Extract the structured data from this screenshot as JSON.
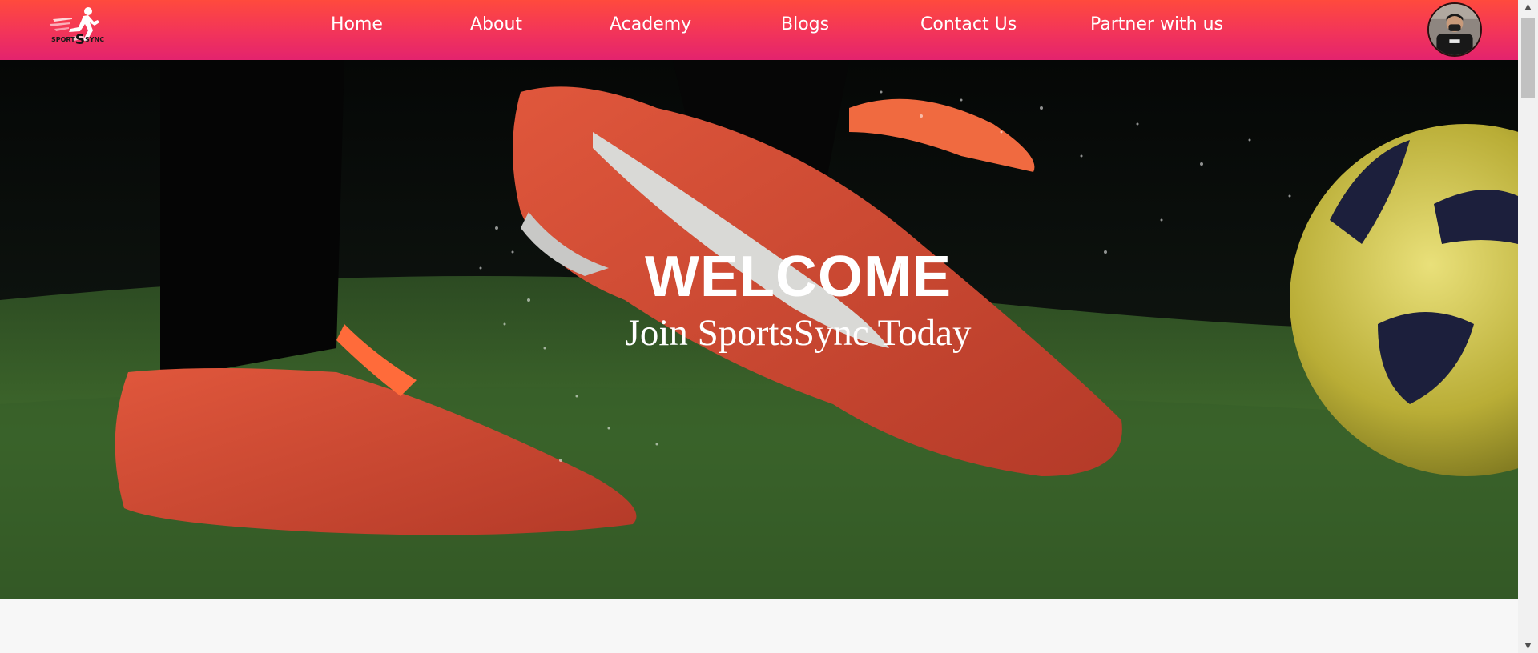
{
  "logo": {
    "prefix": "SPORT",
    "initial": "S",
    "suffix": "SYNC",
    "icon": "runner-icon"
  },
  "nav": {
    "items": [
      {
        "label": "Home"
      },
      {
        "label": "About"
      },
      {
        "label": "Academy"
      },
      {
        "label": "Blogs"
      },
      {
        "label": "Contact Us"
      },
      {
        "label": "Partner with us"
      }
    ],
    "avatar_icon": "user-avatar"
  },
  "hero": {
    "title": "WELCOME",
    "subtitle": "Join SportsSync Today"
  },
  "colors": {
    "navbar_top": "#ff4a3d",
    "navbar_bottom": "#e3236e",
    "hero_text": "#ffffff",
    "page_background": "#f7f7f7"
  }
}
